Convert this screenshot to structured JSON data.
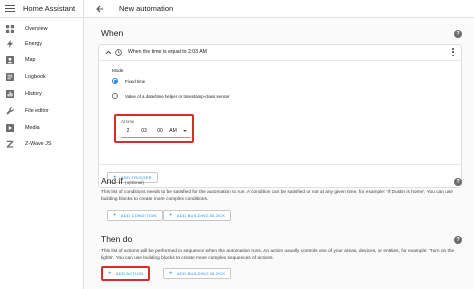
{
  "sidebar": {
    "app_title": "Home Assistant",
    "items": [
      {
        "label": "Overview",
        "icon": "grid-icon"
      },
      {
        "label": "Energy",
        "icon": "bolt-icon"
      },
      {
        "label": "Map",
        "icon": "account-icon"
      },
      {
        "label": "Logbook",
        "icon": "list-icon"
      },
      {
        "label": "History",
        "icon": "chart-icon"
      },
      {
        "label": "File editor",
        "icon": "wrench-icon"
      },
      {
        "label": "Media",
        "icon": "play-icon"
      },
      {
        "label": "Z-Wave JS",
        "icon": "zwave-icon"
      }
    ]
  },
  "header": {
    "title": "New automation"
  },
  "when": {
    "title": "When",
    "trigger": {
      "summary": "When the time is equal to 2:03 AM",
      "mode_label": "Mode",
      "options": [
        "Fixed time",
        "Value of a date/time helper or timestamp-class sensor"
      ],
      "selected_index": 0,
      "time_label": "At time",
      "hour": "2",
      "minute": "03",
      "second": "00",
      "ampm": "AM"
    },
    "add_trigger_label": "ADD TRIGGER"
  },
  "and_if": {
    "title": "And if",
    "optional": "(optional)",
    "description": "This list of conditions needs to be satisfied for the automation to run. A condition can be satisfied or not at any given time, for example: 'If Dustin is home'. You can use building blocks to create more complex conditions.",
    "add_condition_label": "ADD CONDITION",
    "add_block_label": "ADD BUILDING BLOCK"
  },
  "then_do": {
    "title": "Then do",
    "description": "This list of actions will be performed in sequence when the automation runs. An action usually controls one of your areas, devices, or entities, for example: 'Turn on the lights'. You can use building blocks to create more complex sequences of actions.",
    "add_action_label": "ADD ACTION",
    "add_block_label": "ADD BUILDING BLOCK"
  },
  "colors": {
    "accent": "#1e88e5",
    "highlight": "#d32f2f",
    "help": "#6b6b6b"
  }
}
